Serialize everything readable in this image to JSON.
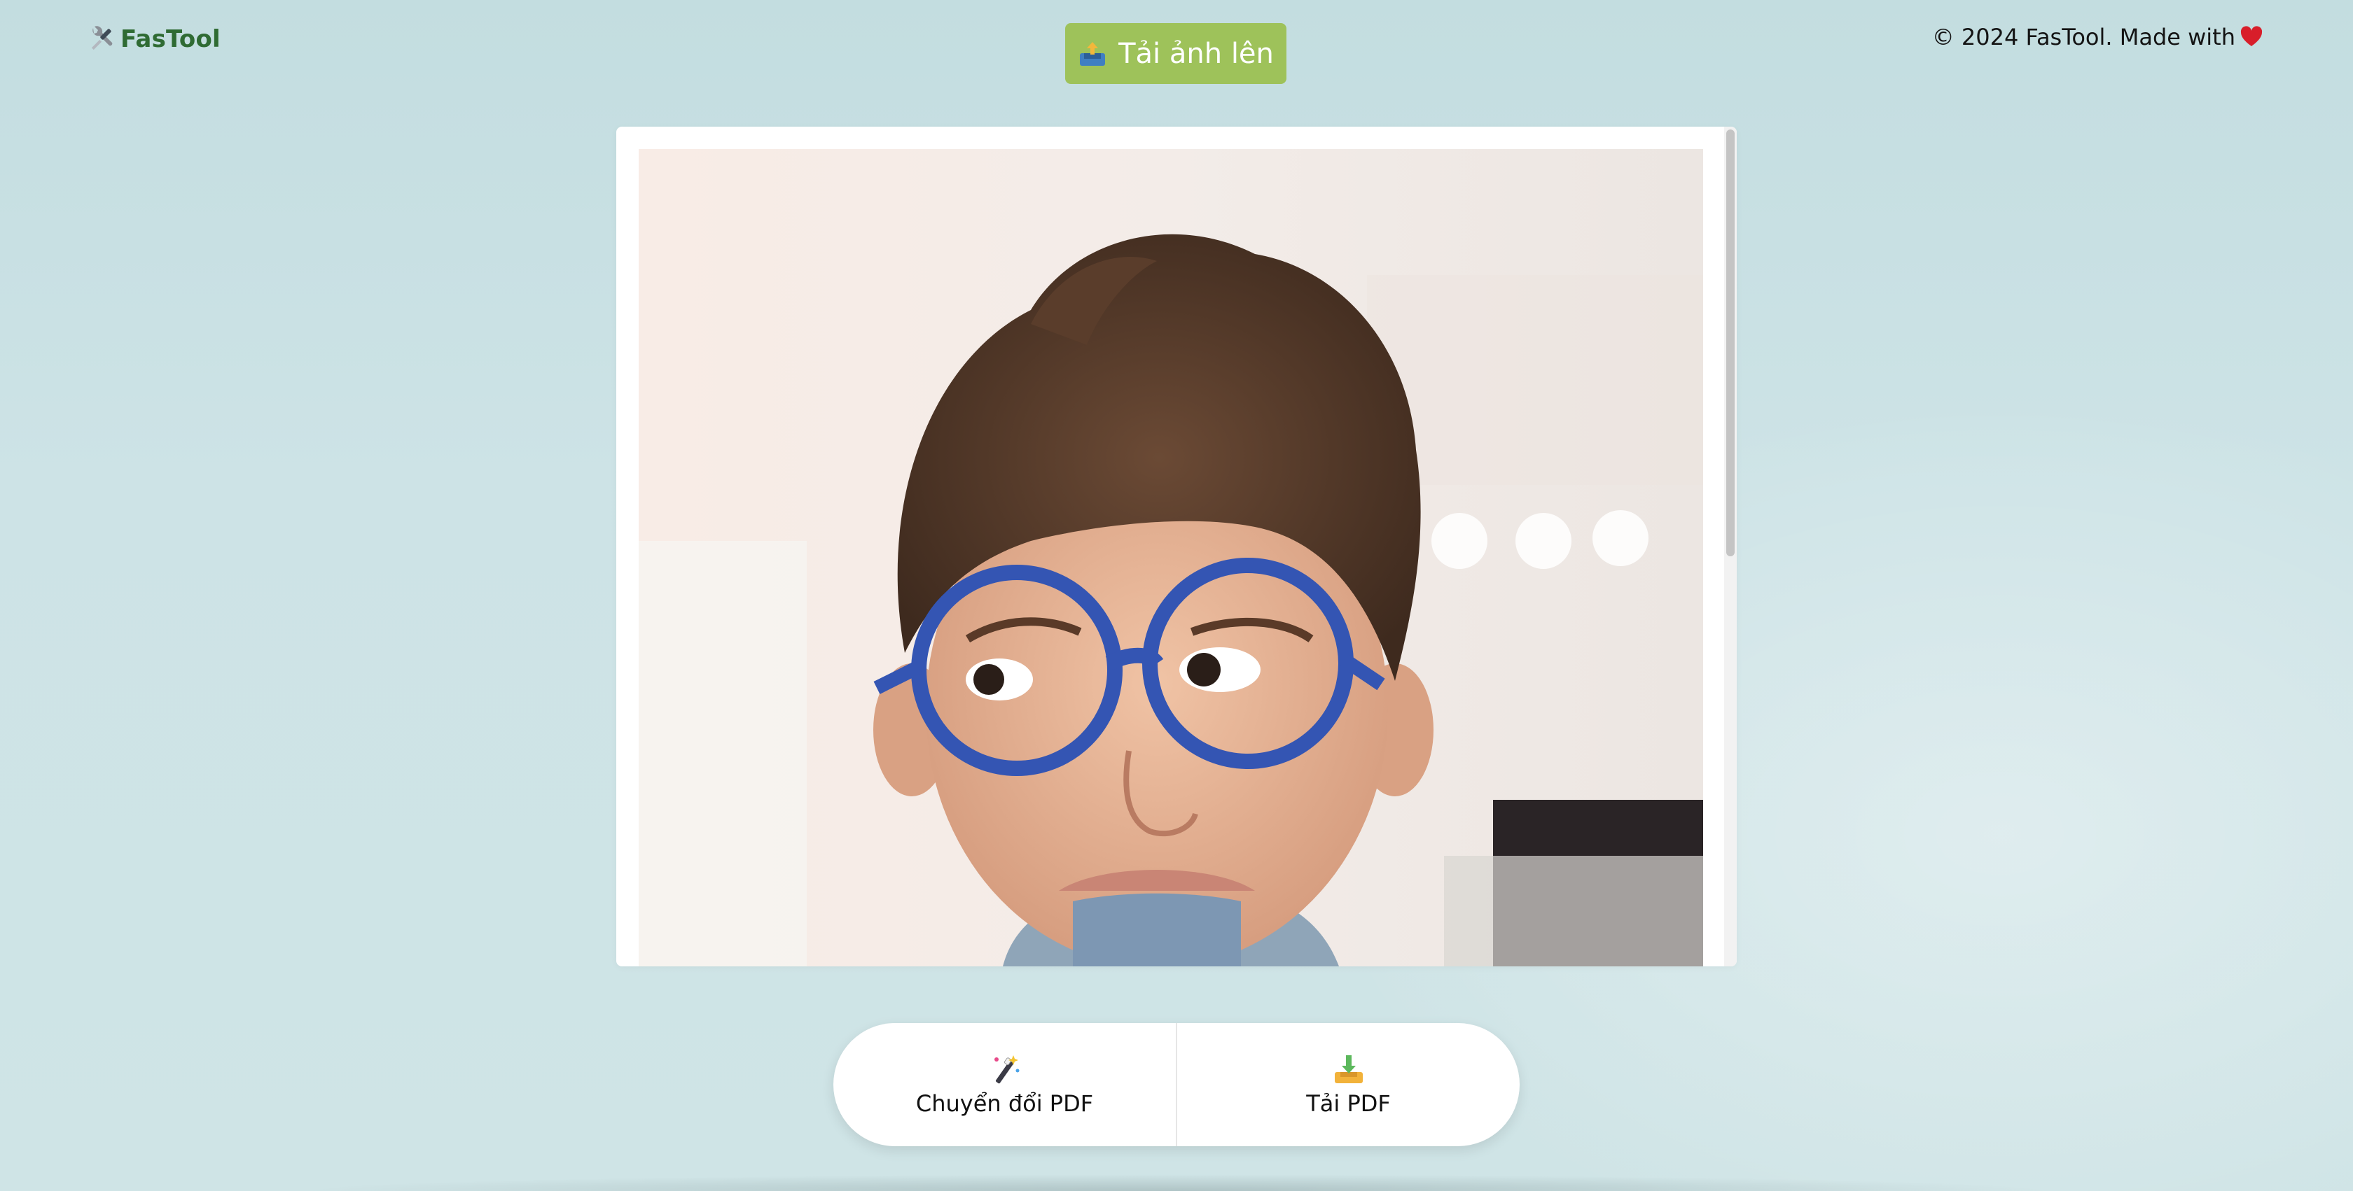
{
  "header": {
    "brand_name": "FasTool",
    "brand_icon": "tools-icon",
    "upload_label": "Tải ảnh lên",
    "upload_icon": "inbox-tray-icon",
    "credit_text": "© 2024 FasTool. Made with",
    "credit_icon": "heart-icon"
  },
  "preview": {
    "image_subject": "child-with-blue-glasses",
    "background_color": "#ffffff"
  },
  "actions": [
    {
      "label": "Chuyển đổi PDF",
      "icon": "magic-wand-icon"
    },
    {
      "label": "Tải PDF",
      "icon": "download-tray-icon"
    }
  ],
  "colors": {
    "brand": "#2f6b33",
    "upload_button": "#9ec25a",
    "page_background": "#c8e0e3",
    "heart": "#d81e2a"
  }
}
